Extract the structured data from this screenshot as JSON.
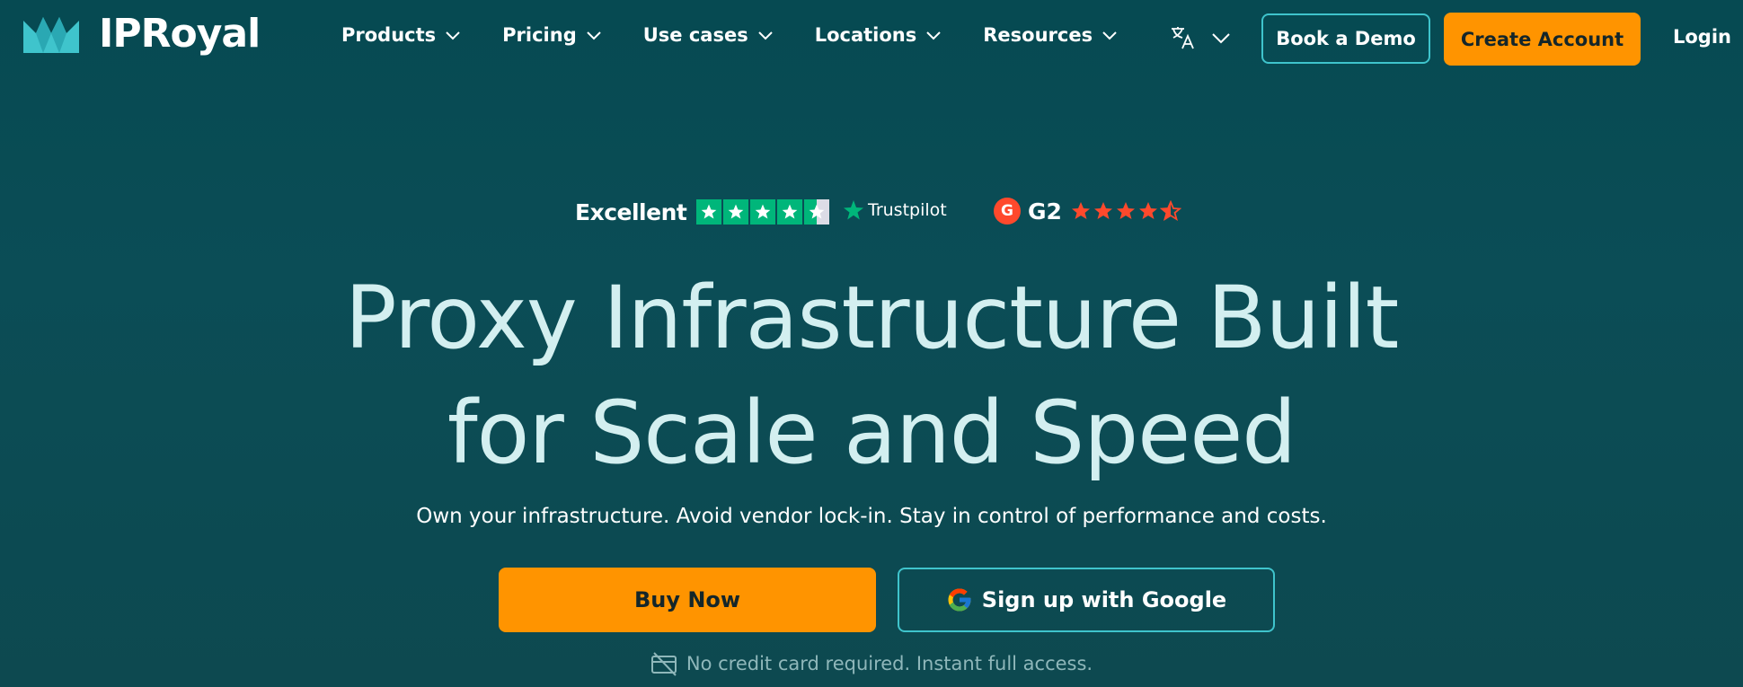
{
  "brand": {
    "name": "IPRoyal",
    "logo_icon": "crown-icon"
  },
  "nav": {
    "menu": [
      {
        "label": "Products"
      },
      {
        "label": "Pricing"
      },
      {
        "label": "Use cases"
      },
      {
        "label": "Locations"
      },
      {
        "label": "Resources"
      }
    ],
    "language_icon": "translate-icon",
    "book_demo": "Book a Demo",
    "create_account": "Create Account",
    "login": "Login"
  },
  "ratings": {
    "trustpilot_label": "Excellent",
    "trustpilot_brand": "Trustpilot",
    "trustpilot_stars": 4.5,
    "g2_brand": "G2",
    "g2_stars": 4.5
  },
  "hero": {
    "headline_line1": "Proxy Infrastructure Built",
    "headline_line2": "for Scale and Speed",
    "subtitle": "Own your infrastructure. Avoid vendor lock-in. Stay in control of performance and costs.",
    "buy_now": "Buy Now",
    "google_signup": "Sign up with Google",
    "note": "No credit card required. Instant full access."
  },
  "colors": {
    "background": "#064a52",
    "accent_orange": "#ff9400",
    "accent_teal": "#3fc4cc",
    "trustpilot_green": "#00b67a",
    "g2_red": "#ff492c"
  }
}
